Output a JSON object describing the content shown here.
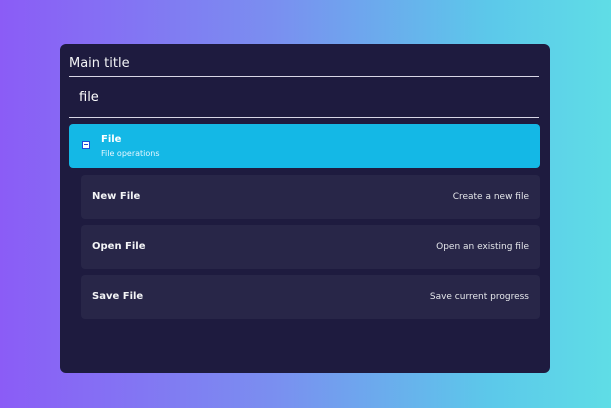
{
  "palette": {
    "title": "Main title",
    "search": {
      "value": "file"
    },
    "group": {
      "icon": "document-icon",
      "title": "File",
      "subtitle": "File operations"
    },
    "items": [
      {
        "name": "New File",
        "description": "Create a new file"
      },
      {
        "name": "Open File",
        "description": "Open an existing file"
      },
      {
        "name": "Save File",
        "description": "Save current progress"
      }
    ]
  },
  "colors": {
    "panel": "#1e1b3f",
    "accent": "#14b8e6",
    "item": "#282648",
    "text": "#f3f4f6"
  }
}
